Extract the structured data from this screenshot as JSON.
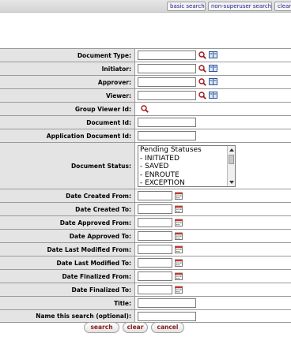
{
  "toolbar": {
    "basic_search": "basic search",
    "non_superuser_search": "non-superuser search",
    "clear": "clear"
  },
  "form": {
    "document_type": "Document Type:",
    "initiator": "Initiator:",
    "approver": "Approver:",
    "viewer": "Viewer:",
    "group_viewer_id": "Group Viewer Id:",
    "document_id": "Document Id:",
    "application_document_id": "Application Document Id:",
    "document_status": "Document Status:",
    "date_created_from": "Date Created From:",
    "date_created_to": "Date Created To:",
    "date_approved_from": "Date Approved From:",
    "date_approved_to": "Date Approved To:",
    "date_last_modified_from": "Date Last Modified From:",
    "date_last_modified_to": "Date Last Modified To:",
    "date_finalized_from": "Date Finalized From:",
    "date_finalized_to": "Date Finalized To:",
    "title": "Title:",
    "name_this_search": "Name this search (optional):"
  },
  "status_options": [
    "Pending Statuses",
    "- INITIATED",
    "- SAVED",
    "- ENROUTE",
    "- EXCEPTION"
  ],
  "actions": {
    "search": "search",
    "clear": "clear",
    "cancel": "cancel"
  },
  "icons": {
    "lookup": "magnifier-icon",
    "inquiry": "book-icon",
    "calendar": "calendar-icon"
  },
  "colors": {
    "label_bg": "#e4e4e4",
    "border": "#9a9a9a",
    "button_text": "#8b1a1a"
  }
}
